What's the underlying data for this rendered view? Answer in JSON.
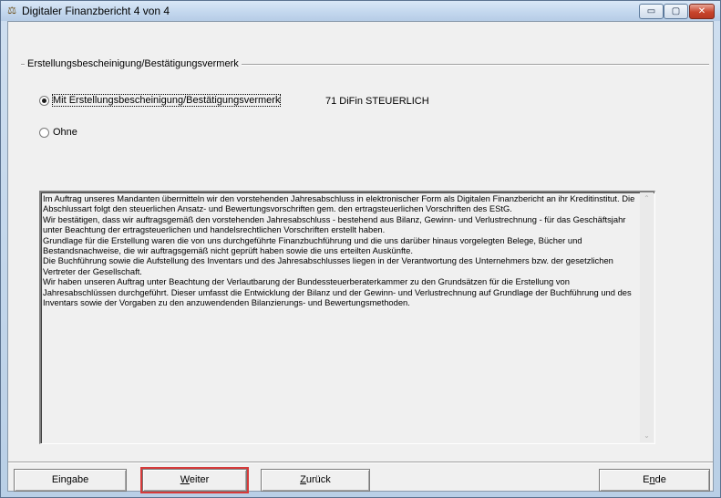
{
  "window": {
    "title": "Digitaler Finanzbericht 4 von 4",
    "minimize_glyph": "▭",
    "maximize_glyph": "▢",
    "close_glyph": "✕"
  },
  "group": {
    "label": "Erstellungsbescheinigung/Bestätigungsvermerk"
  },
  "options": [
    {
      "label": "Mit Erstellungsbescheinigung/Bestätigungsvermerk",
      "checked": true
    },
    {
      "label": "Ohne",
      "checked": false
    }
  ],
  "option_info": "71 DiFin STEUERLICH",
  "text": [
    "Im Auftrag unseres Mandanten übermitteln wir den vorstehenden Jahresabschluss in elektronischer Form als Digitalen Finanzbericht an ihr Kreditinstitut. Die Abschlussart folgt den steuerlichen Ansatz- und Bewertungsvorschriften gem. den ertragsteuerlichen Vorschriften des EStG.",
    "Wir bestätigen, dass wir auftragsgemäß den vorstehenden Jahresabschluss - bestehend aus Bilanz, Gewinn- und Verlustrechnung - für das Geschäftsjahr unter Beachtung der ertragsteuerlichen und handelsrechtlichen Vorschriften erstellt haben.",
    "Grundlage für die Erstellung waren die von uns durchgeführte Finanzbuchführung und die uns darüber hinaus vorgelegten Belege, Bücher und Bestandsnachweise, die wir auftragsgemäß nicht geprüft haben sowie die uns erteilten Auskünfte.",
    "Die Buchführung sowie die Aufstellung des Inventars und des Jahresabschlusses liegen in der Verantwortung des Unternehmers bzw. der gesetzlichen Vertreter der Gesellschaft.",
    "Wir haben unseren Auftrag unter Beachtung der Verlautbarung der Bundessteuerberaterkammer zu den Grundsätzen für die Erstellung von Jahresabschlüssen durchgeführt. Dieser umfasst die Entwicklung der Bilanz und der Gewinn- und Verlustrechnung auf Grundlage der Buchführung und des Inventars sowie der Vorgaben zu den anzuwendenden Bilanzierungs- und Bewertungsmethoden."
  ],
  "scroll": {
    "up_glyph": "⌃",
    "down_glyph": "⌄"
  },
  "buttons": {
    "eingabe": "Eingabe",
    "weiter_accel": "W",
    "weiter_rest": "eiter",
    "zurueck_accel": "Z",
    "zurueck_rest": "urück",
    "ende_pre": "E",
    "ende_accel": "n",
    "ende_rest": "de"
  }
}
